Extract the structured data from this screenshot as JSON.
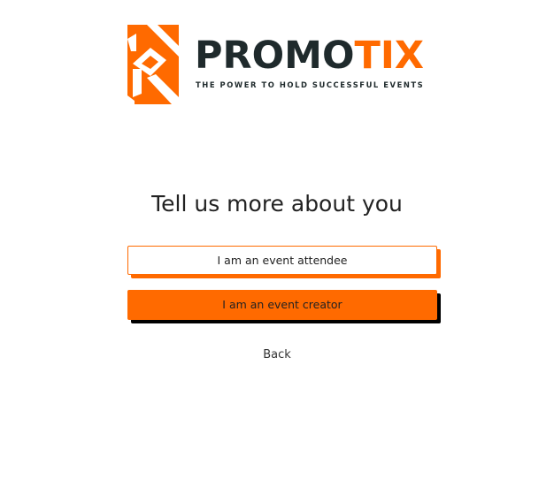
{
  "brand": {
    "name_part1": "PROMO",
    "name_part2": "TIX",
    "tagline": "THE POWER TO HOLD SUCCESSFUL EVENTS",
    "accent_color": "#ff6a00",
    "dark_color": "#1f2a2c",
    "logo_icon": "promotix-logo-icon"
  },
  "onboarding": {
    "heading": "Tell us more about you",
    "options": [
      {
        "label": "I am an event attendee"
      },
      {
        "label": "I am an event creator"
      }
    ],
    "back_label": "Back"
  }
}
